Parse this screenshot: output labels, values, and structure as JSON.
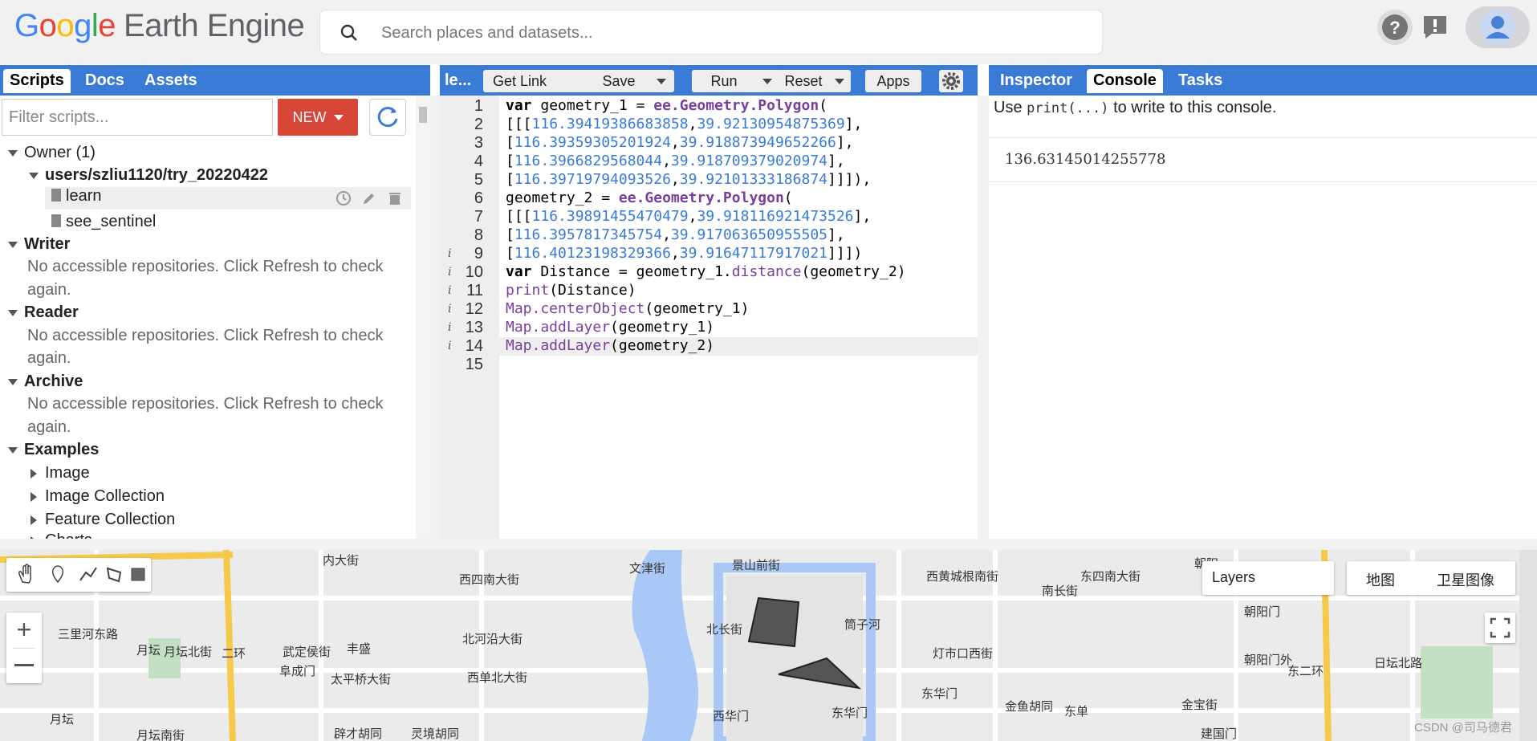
{
  "app": {
    "logo_google": [
      "G",
      "o",
      "o",
      "g",
      "l",
      "e"
    ],
    "logo_product": "Earth Engine"
  },
  "search": {
    "placeholder": "Search places and datasets..."
  },
  "left_tabs": [
    "Scripts",
    "Docs",
    "Assets"
  ],
  "scripts": {
    "filter_placeholder": "Filter scripts...",
    "new_label": "NEW",
    "owner_label": "Owner (1)",
    "repo_label": "users/szliu1120/try_20220422",
    "files": [
      "learn",
      "see_sentinel"
    ],
    "writer_label": "Writer",
    "reader_label": "Reader",
    "archive_label": "Archive",
    "empty_message_line1": "No accessible repositories. Click Refresh to check",
    "empty_message_line2": "again.",
    "examples_label": "Examples",
    "example_items": [
      "Image",
      "Image Collection",
      "Feature Collection",
      "Charts"
    ]
  },
  "editor_bar": {
    "script_name": "le...",
    "get_link": "Get Link",
    "save": "Save",
    "run": "Run",
    "reset": "Reset",
    "apps": "Apps"
  },
  "code_lines": [
    "var geometry_1 = ee.Geometry.Polygon(",
    "[[[116.39419386683858,39.92130954875369],",
    "[116.39359305201924,39.918873949652266],",
    "[116.3966829568044,39.918709379020974],",
    "[116.39719794093526,39.92101333186874]]]),",
    "geometry_2 = ee.Geometry.Polygon(",
    "[[[116.39891455470479,39.918116921473526],",
    "[116.3957817345754,39.917063650955505],",
    "[116.40123198329366,39.91647117917021]]])",
    "var Distance = geometry_1.distance(geometry_2)",
    "print(Distance)",
    "Map.centerObject(geometry_1)",
    "Map.addLayer(geometry_1)",
    "Map.addLayer(geometry_2)",
    ""
  ],
  "right_tabs": [
    "Inspector",
    "Console",
    "Tasks"
  ],
  "console": {
    "hint_prefix": "Use",
    "hint_code": "print(...)",
    "hint_suffix": "to write to this console.",
    "output": "136.63145014255778"
  },
  "map": {
    "layers_label": "Layers",
    "map_type_map": "地图",
    "map_type_satellite": "卫星图像",
    "labels": [
      "文津街",
      "景山前街",
      "朝阳",
      "西四南大街",
      "西黄城根南街",
      "北长街",
      "筒子河",
      "灯市口西街",
      "东四南大街",
      "月坛北街",
      "武定侯街",
      "丰盛",
      "阜成门",
      "月坛",
      "二环",
      "西华门",
      "东华门",
      "东单",
      "金宝街",
      "朝阳门",
      "朝阳门外",
      "日坛北路",
      "东二环",
      "东华门",
      "北河沿大街",
      "南长街",
      "西单北大街",
      "太平桥大街",
      "三里河东路",
      "月坛南街",
      "辟才胡同",
      "灵境胡同",
      "建国门",
      "金鱼胡同",
      "内大街",
      "月坛"
    ],
    "watermark": "CSDN @司马德君"
  }
}
